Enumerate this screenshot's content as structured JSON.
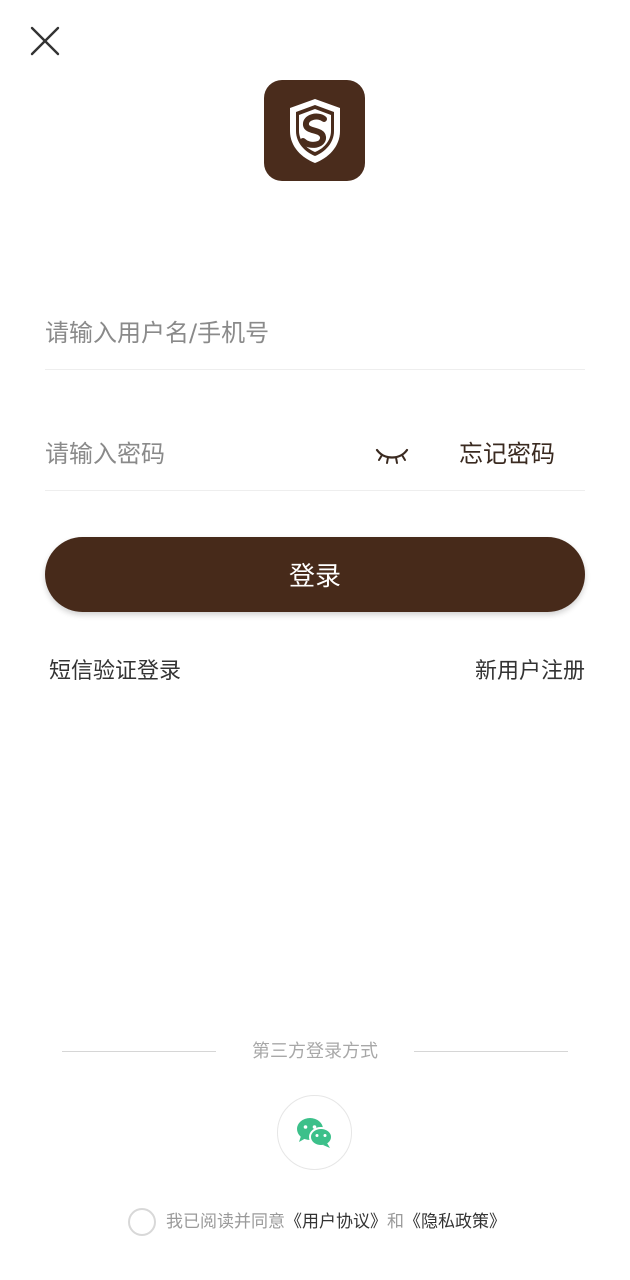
{
  "icons": {
    "close": "close-icon",
    "logo": "shield-s-logo",
    "eye": "eye-closed-icon",
    "wechat": "wechat-icon"
  },
  "colors": {
    "brand": "#472a1a",
    "wechat_green": "#3cc08a",
    "text_primary": "#333333",
    "placeholder": "#8a8a8a"
  },
  "form": {
    "username_placeholder": "请输入用户名/手机号",
    "username_value": "",
    "password_placeholder": "请输入密码",
    "password_value": "",
    "forgot_password": "忘记密码",
    "login_button": "登录"
  },
  "links": {
    "sms_login": "短信验证登录",
    "register": "新用户注册"
  },
  "third_party": {
    "label": "第三方登录方式"
  },
  "agreement": {
    "prefix": "我已阅读并同意",
    "user_agreement": "《用户协议》",
    "conjunction": "和",
    "privacy_policy": "《隐私政策》"
  }
}
